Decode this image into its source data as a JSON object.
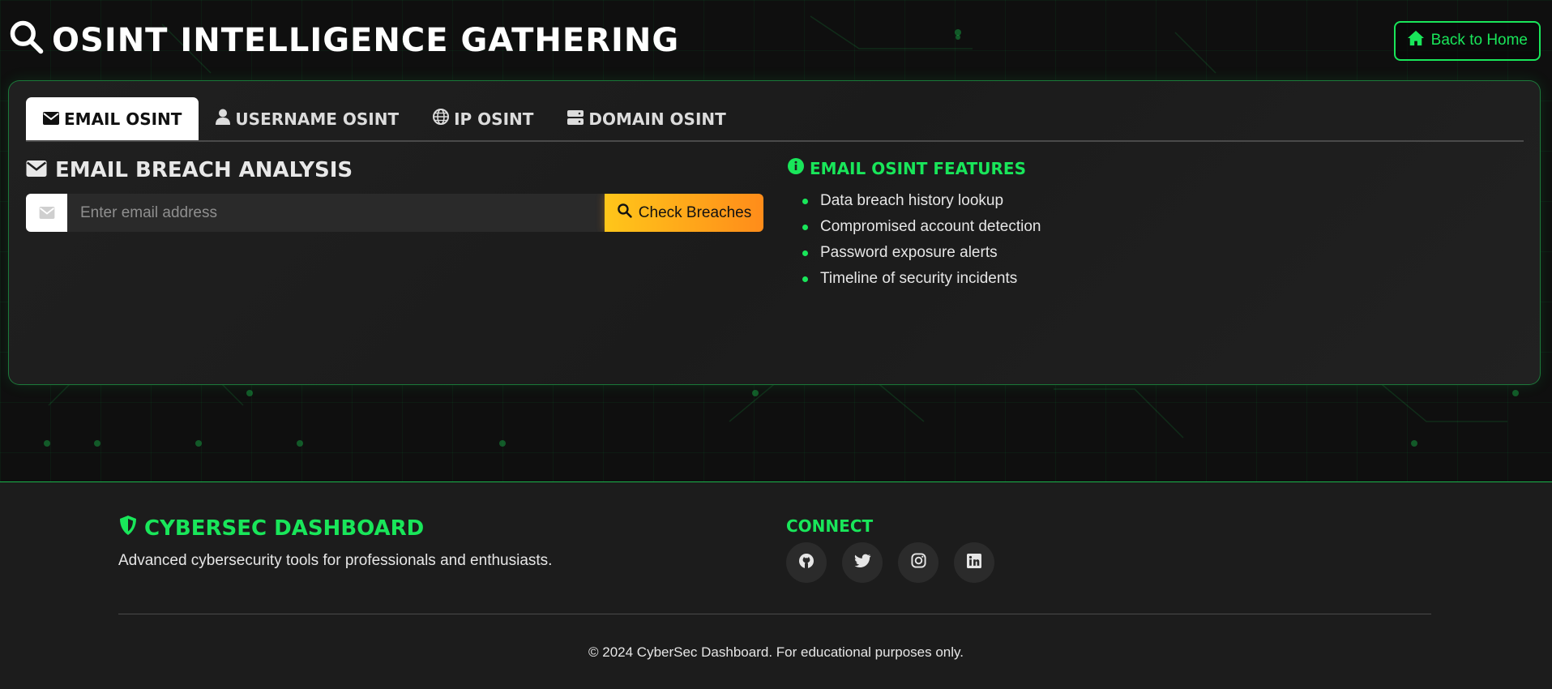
{
  "header": {
    "title": "OSINT INTELLIGENCE GATHERING",
    "back_label": "Back to Home"
  },
  "tabs": [
    {
      "label": "EMAIL OSINT",
      "icon": "envelope-icon",
      "active": true
    },
    {
      "label": "USERNAME OSINT",
      "icon": "user-icon",
      "active": false
    },
    {
      "label": "IP OSINT",
      "icon": "globe-icon",
      "active": false
    },
    {
      "label": "DOMAIN OSINT",
      "icon": "server-icon",
      "active": false
    }
  ],
  "email_section": {
    "title": "EMAIL BREACH ANALYSIS",
    "input_placeholder": "Enter email address",
    "input_value": "",
    "button_label": "Check Breaches"
  },
  "features": {
    "title": "EMAIL OSINT FEATURES",
    "items": [
      "Data breach history lookup",
      "Compromised account detection",
      "Password exposure alerts",
      "Timeline of security incidents"
    ]
  },
  "footer": {
    "brand": "CYBERSEC DASHBOARD",
    "description": "Advanced cybersecurity tools for professionals and enthusiasts.",
    "connect_title": "CONNECT",
    "socials": [
      "github-icon",
      "twitter-icon",
      "instagram-icon",
      "linkedin-icon"
    ],
    "copyright": "© 2024 CyberSec Dashboard. For educational purposes only."
  },
  "colors": {
    "accent": "#19e65a",
    "button_gradient_start": "#ffc61a",
    "button_gradient_end": "#ff8c1a",
    "background": "#0d0d0d",
    "panel": "#1e1e1e"
  }
}
